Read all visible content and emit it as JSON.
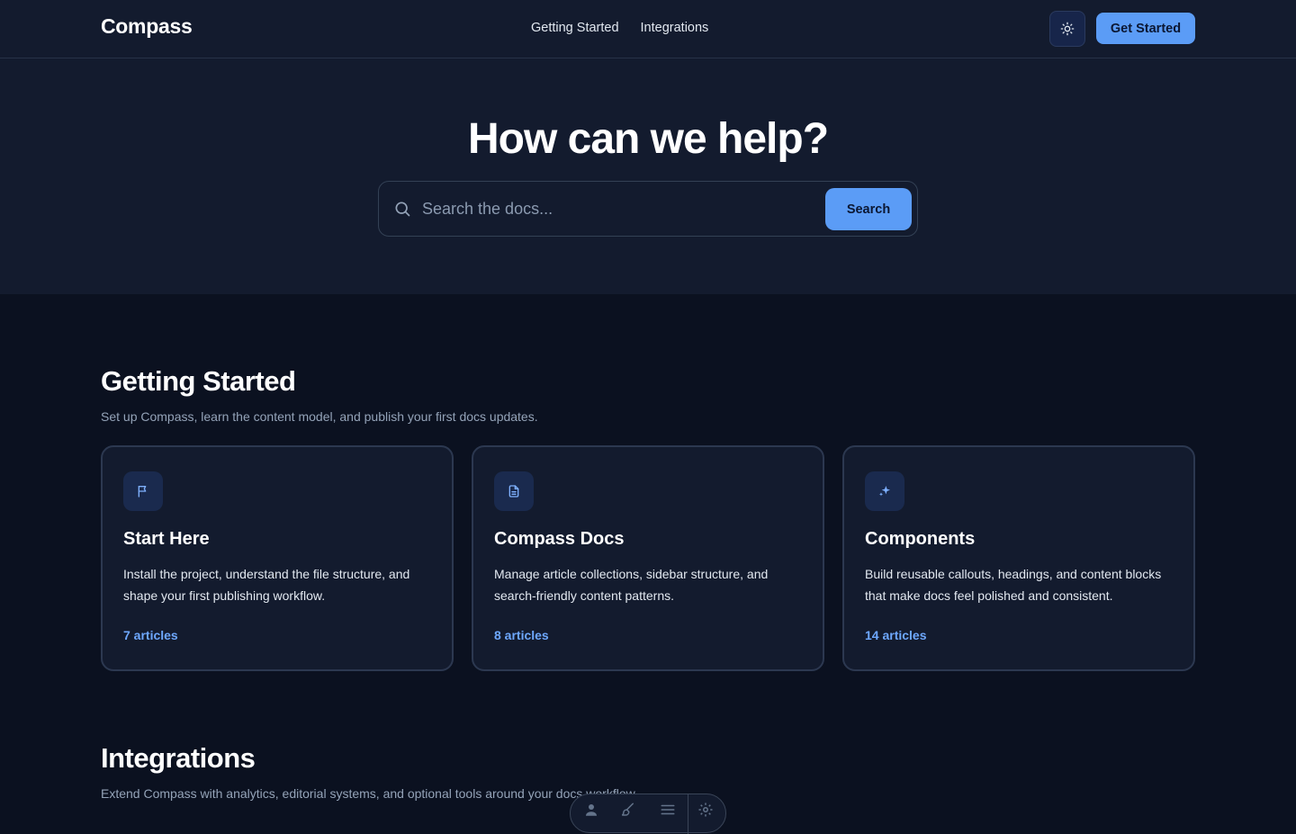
{
  "header": {
    "logo": "Compass",
    "nav": [
      "Getting Started",
      "Integrations"
    ],
    "theme_toggle_icon": "sun-icon",
    "cta_label": "Get Started"
  },
  "hero": {
    "title": "How can we help?",
    "search_placeholder": "Search the docs...",
    "search_value": "",
    "search_button": "Search"
  },
  "sections": [
    {
      "title": "Getting Started",
      "subtitle": "Set up Compass, learn the content model, and publish your first docs updates.",
      "cards": [
        {
          "icon": "flag-icon",
          "title": "Start Here",
          "description": "Install the project, understand the file structure, and shape your first publishing workflow.",
          "count": "7 articles"
        },
        {
          "icon": "document-icon",
          "title": "Compass Docs",
          "description": "Manage article collections, sidebar structure, and search-friendly content patterns.",
          "count": "8 articles"
        },
        {
          "icon": "sparkle-icon",
          "title": "Components",
          "description": "Build reusable callouts, headings, and content blocks that make docs feel polished and consistent.",
          "count": "14 articles"
        }
      ]
    },
    {
      "title": "Integrations",
      "subtitle": "Extend Compass with analytics, editorial systems, and optional tools around your docs workflow."
    }
  ],
  "dock": {
    "items": [
      "user-icon",
      "brush-icon",
      "menu-icon",
      "settings-icon"
    ]
  },
  "colors": {
    "background": "#0b1120",
    "surface": "#131b2e",
    "accent": "#5b9cf6",
    "link": "#6ea8fe",
    "border": "#2c3850"
  }
}
